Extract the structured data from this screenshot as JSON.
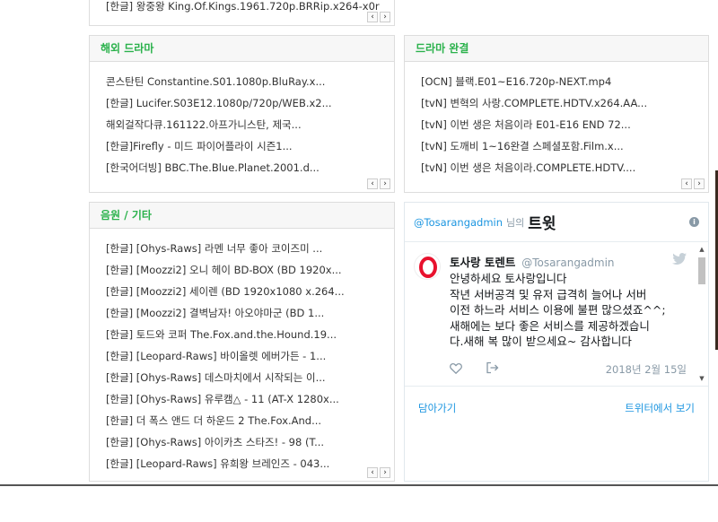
{
  "top_panel": {
    "item": "[한글] 왕중왕 King.Of.Kings.1961.720p.BRRip.x264-x0r"
  },
  "foreign_drama": {
    "title": "해외 드라마",
    "items": [
      "콘스탄틴 Constantine.S01.1080p.BluRay.x...",
      "[한글] Lucifer.S03E12.1080p/720p/WEB.x2...",
      "해외걸작다큐.161122.아프가니스탄, 제국...",
      "[한글]Firefly - 미드 파이어플라이 시즌1...",
      "[한국어더빙] BBC.The.Blue.Planet.2001.d..."
    ]
  },
  "drama_complete": {
    "title": "드라마 완결",
    "items": [
      "[OCN] 블랙.E01~E16.720p-NEXT.mp4",
      "[tvN] 변혁의 사랑.COMPLETE.HDTV.x264.AA...",
      "[tvN] 이번 생은 처음이라 E01-E16 END 72...",
      "[tvN] 도깨비 1~16완결 스페셜포함.Film.x...",
      "[tvN] 이번 생은 처음이라.COMPLETE.HDTV...."
    ]
  },
  "music_etc": {
    "title": "음원 / 기타",
    "items": [
      "[한글] [Ohys-Raws] 라멘 너무 좋아 코이즈미 ...",
      "[한글] [Moozzi2] 오니 헤이 BD-BOX (BD 1920x...",
      "[한글] [Moozzi2] 세이렌 (BD 1920x1080 x.264...",
      "[한글] [Moozzi2] 결벽남자! 아오야마군 (BD 1...",
      "[한글] 토드와 코퍼 The.Fox.and.the.Hound.19...",
      "[한글] [Leopard-Raws] 바이올렛 에버가든 - 1...",
      "[한글] [Ohys-Raws] 데스마치에서 시작되는 이...",
      "[한글] [Ohys-Raws] 유루캠△ - 11 (AT-X 1280x...",
      "[한글] 더 폭스 앤드 더 하운드 2 The.Fox.And...",
      "[한글] [Ohys-Raws] 아이카츠 스타즈! - 98 (T...",
      "[한글] [Leopard-Raws] 유희왕 브레인즈 - 043..."
    ]
  },
  "pager": {
    "prev": "‹",
    "next": "›"
  },
  "twitter": {
    "handle": "@Tosarangadmin",
    "by": "님의",
    "title": "트윗",
    "info_icon": "i",
    "tweet": {
      "name": "토사랑 토렌트",
      "handle": "@Tosarangadmin",
      "text_lines": [
        "안녕하세요 토사랑입니다",
        "작년  서버공격 및 유저 급격히 늘어나 서버",
        "이전 하느라 서비스 이용에 불편 많으셨죠^^;",
        "새해에는 보다 좋은 서비스를 제공하겠습니",
        "다.새해 복 많이 받으세요~ 감사합니다"
      ],
      "date": "2018년 2월 15일"
    },
    "embed_link": "담아가기",
    "view_link": "트위터에서 보기"
  },
  "colors": {
    "accent": "#2bb24c",
    "twitter_blue": "#1b95e0",
    "avatar_red": "#e8112d"
  }
}
